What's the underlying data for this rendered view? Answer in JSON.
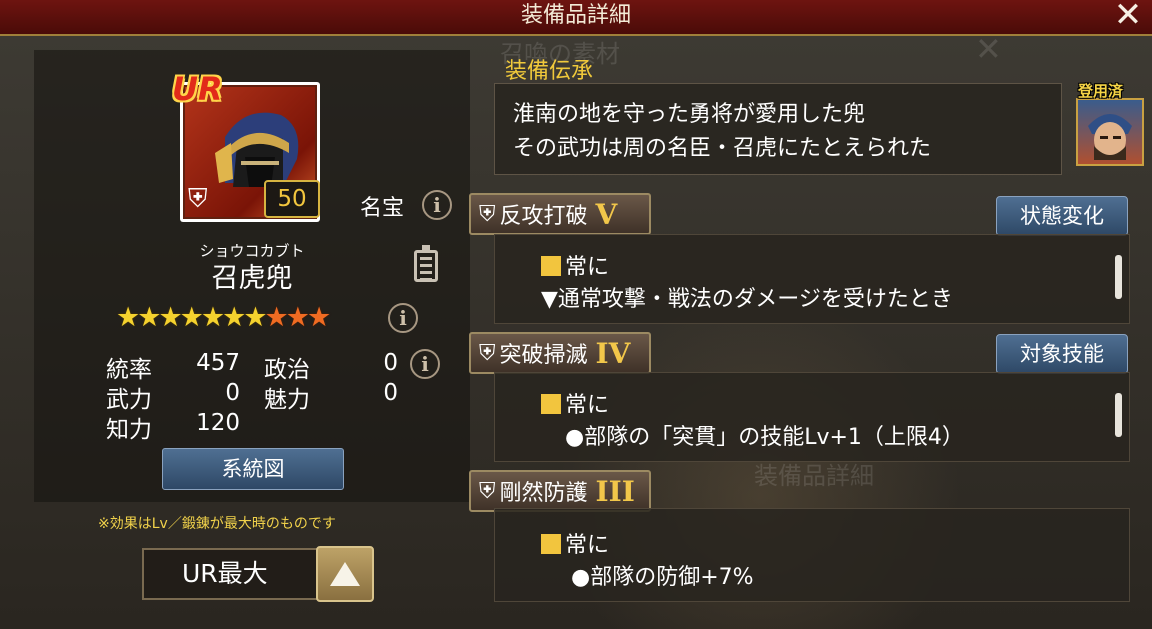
{
  "window": {
    "title": "装備品詳細"
  },
  "item": {
    "rarity": "UR",
    "level": "50",
    "furigana": "ショウコカブト",
    "name": "召虎兜",
    "treasure_label": "名宝",
    "stars_total": 10,
    "stars_yellow": 7,
    "stars_orange": 3
  },
  "stats": {
    "command": {
      "label": "統率",
      "value": "457"
    },
    "politics": {
      "label": "政治",
      "value": "0"
    },
    "war": {
      "label": "武力",
      "value": "0"
    },
    "charm": {
      "label": "魅力",
      "value": "0"
    },
    "intellect": {
      "label": "知力",
      "value": "120"
    }
  },
  "buttons": {
    "lineage": "系統図",
    "state_change": "状態変化",
    "target_skill": "対象技能"
  },
  "note": "※効果はLv／鍛錬が最大時のものです",
  "selector": {
    "value": "UR最大"
  },
  "lore": {
    "title": "装備伝承",
    "line1": "淮南の地を守った勇将が愛用した兜",
    "line2": "その武功は周の名臣・召虎にたとえられた"
  },
  "equipped": "登用済",
  "skills": [
    {
      "name": "反攻打破",
      "rank": "V",
      "condition": "常に",
      "effect": "▼通常攻撃・戦法のダメージを受けたとき"
    },
    {
      "name": "突破掃滅",
      "rank": "IV",
      "condition": "常に",
      "effect": "●部隊の「突貫」の技能Lv+1（上限4）"
    },
    {
      "name": "剛然防護",
      "rank": "III",
      "condition": "常に",
      "effect": "●部隊の防御+7%"
    }
  ],
  "colors": {
    "accent": "#f0c93b",
    "title_bar": "#6e1410",
    "button": "#3e5a7c"
  },
  "icons": [
    "close-icon",
    "info-icon",
    "clipboard-icon",
    "armor-icon",
    "up-arrow-icon",
    "star-icon"
  ]
}
